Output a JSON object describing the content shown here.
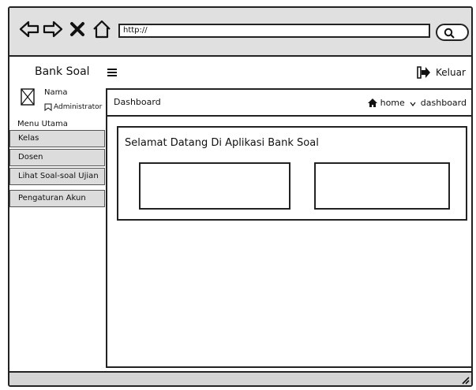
{
  "browser": {
    "url": "http://"
  },
  "header": {
    "brand": "Bank Soal",
    "logout_label": "Keluar"
  },
  "sidebar": {
    "user_name": "Nama",
    "user_role": "Administrator",
    "menu_title": "Menu Utama",
    "items": [
      {
        "label": "Kelas"
      },
      {
        "label": "Dosen"
      },
      {
        "label": "Lihat Soal-soal Ujian"
      },
      {
        "label": "Pengaturan Akun"
      }
    ]
  },
  "main": {
    "page_title": "Dashboard",
    "breadcrumb": [
      "home",
      "dashboard"
    ],
    "welcome_text": "Selamat Datang Di Aplikasi Bank Soal"
  }
}
